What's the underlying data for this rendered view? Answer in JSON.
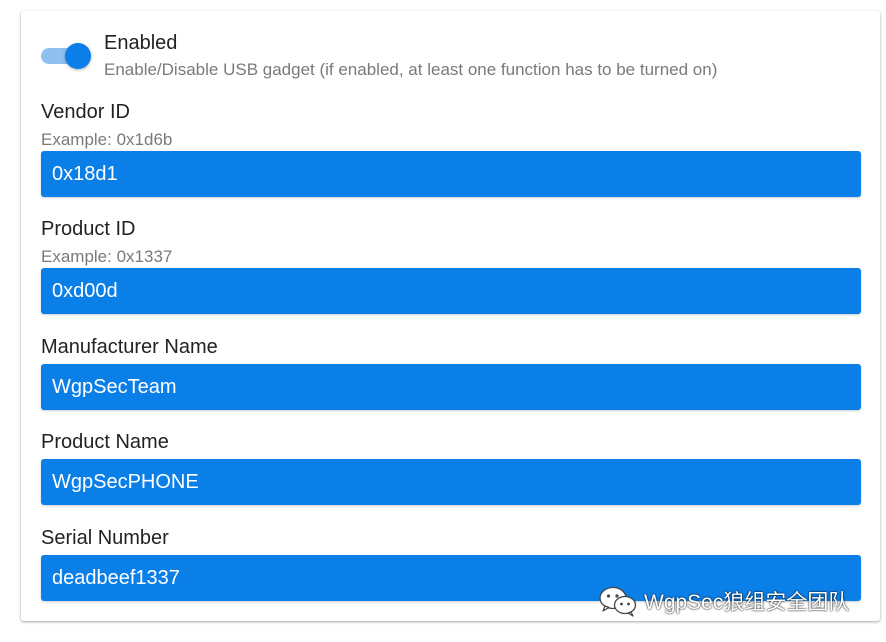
{
  "toggle": {
    "title": "Enabled",
    "description": "Enable/Disable USB gadget (if enabled, at least one function has to be turned on)",
    "checked": true
  },
  "fields": {
    "vendor_id": {
      "label": "Vendor ID",
      "hint": "Example: 0x1d6b",
      "value": "0x18d1"
    },
    "product_id": {
      "label": "Product ID",
      "hint": "Example: 0x1337",
      "value": "0xd00d"
    },
    "manufacturer_name": {
      "label": "Manufacturer Name",
      "value": "WgpSecTeam"
    },
    "product_name": {
      "label": "Product Name",
      "value": "WgpSecPHONE"
    },
    "serial_number": {
      "label": "Serial Number",
      "value": "deadbeef1337"
    }
  },
  "watermark": {
    "text": "WgpSec狼组安全团队",
    "icon": "wechat-icon"
  },
  "colors": {
    "accent": "#0b7fe8",
    "track": "#8ec0f2"
  }
}
